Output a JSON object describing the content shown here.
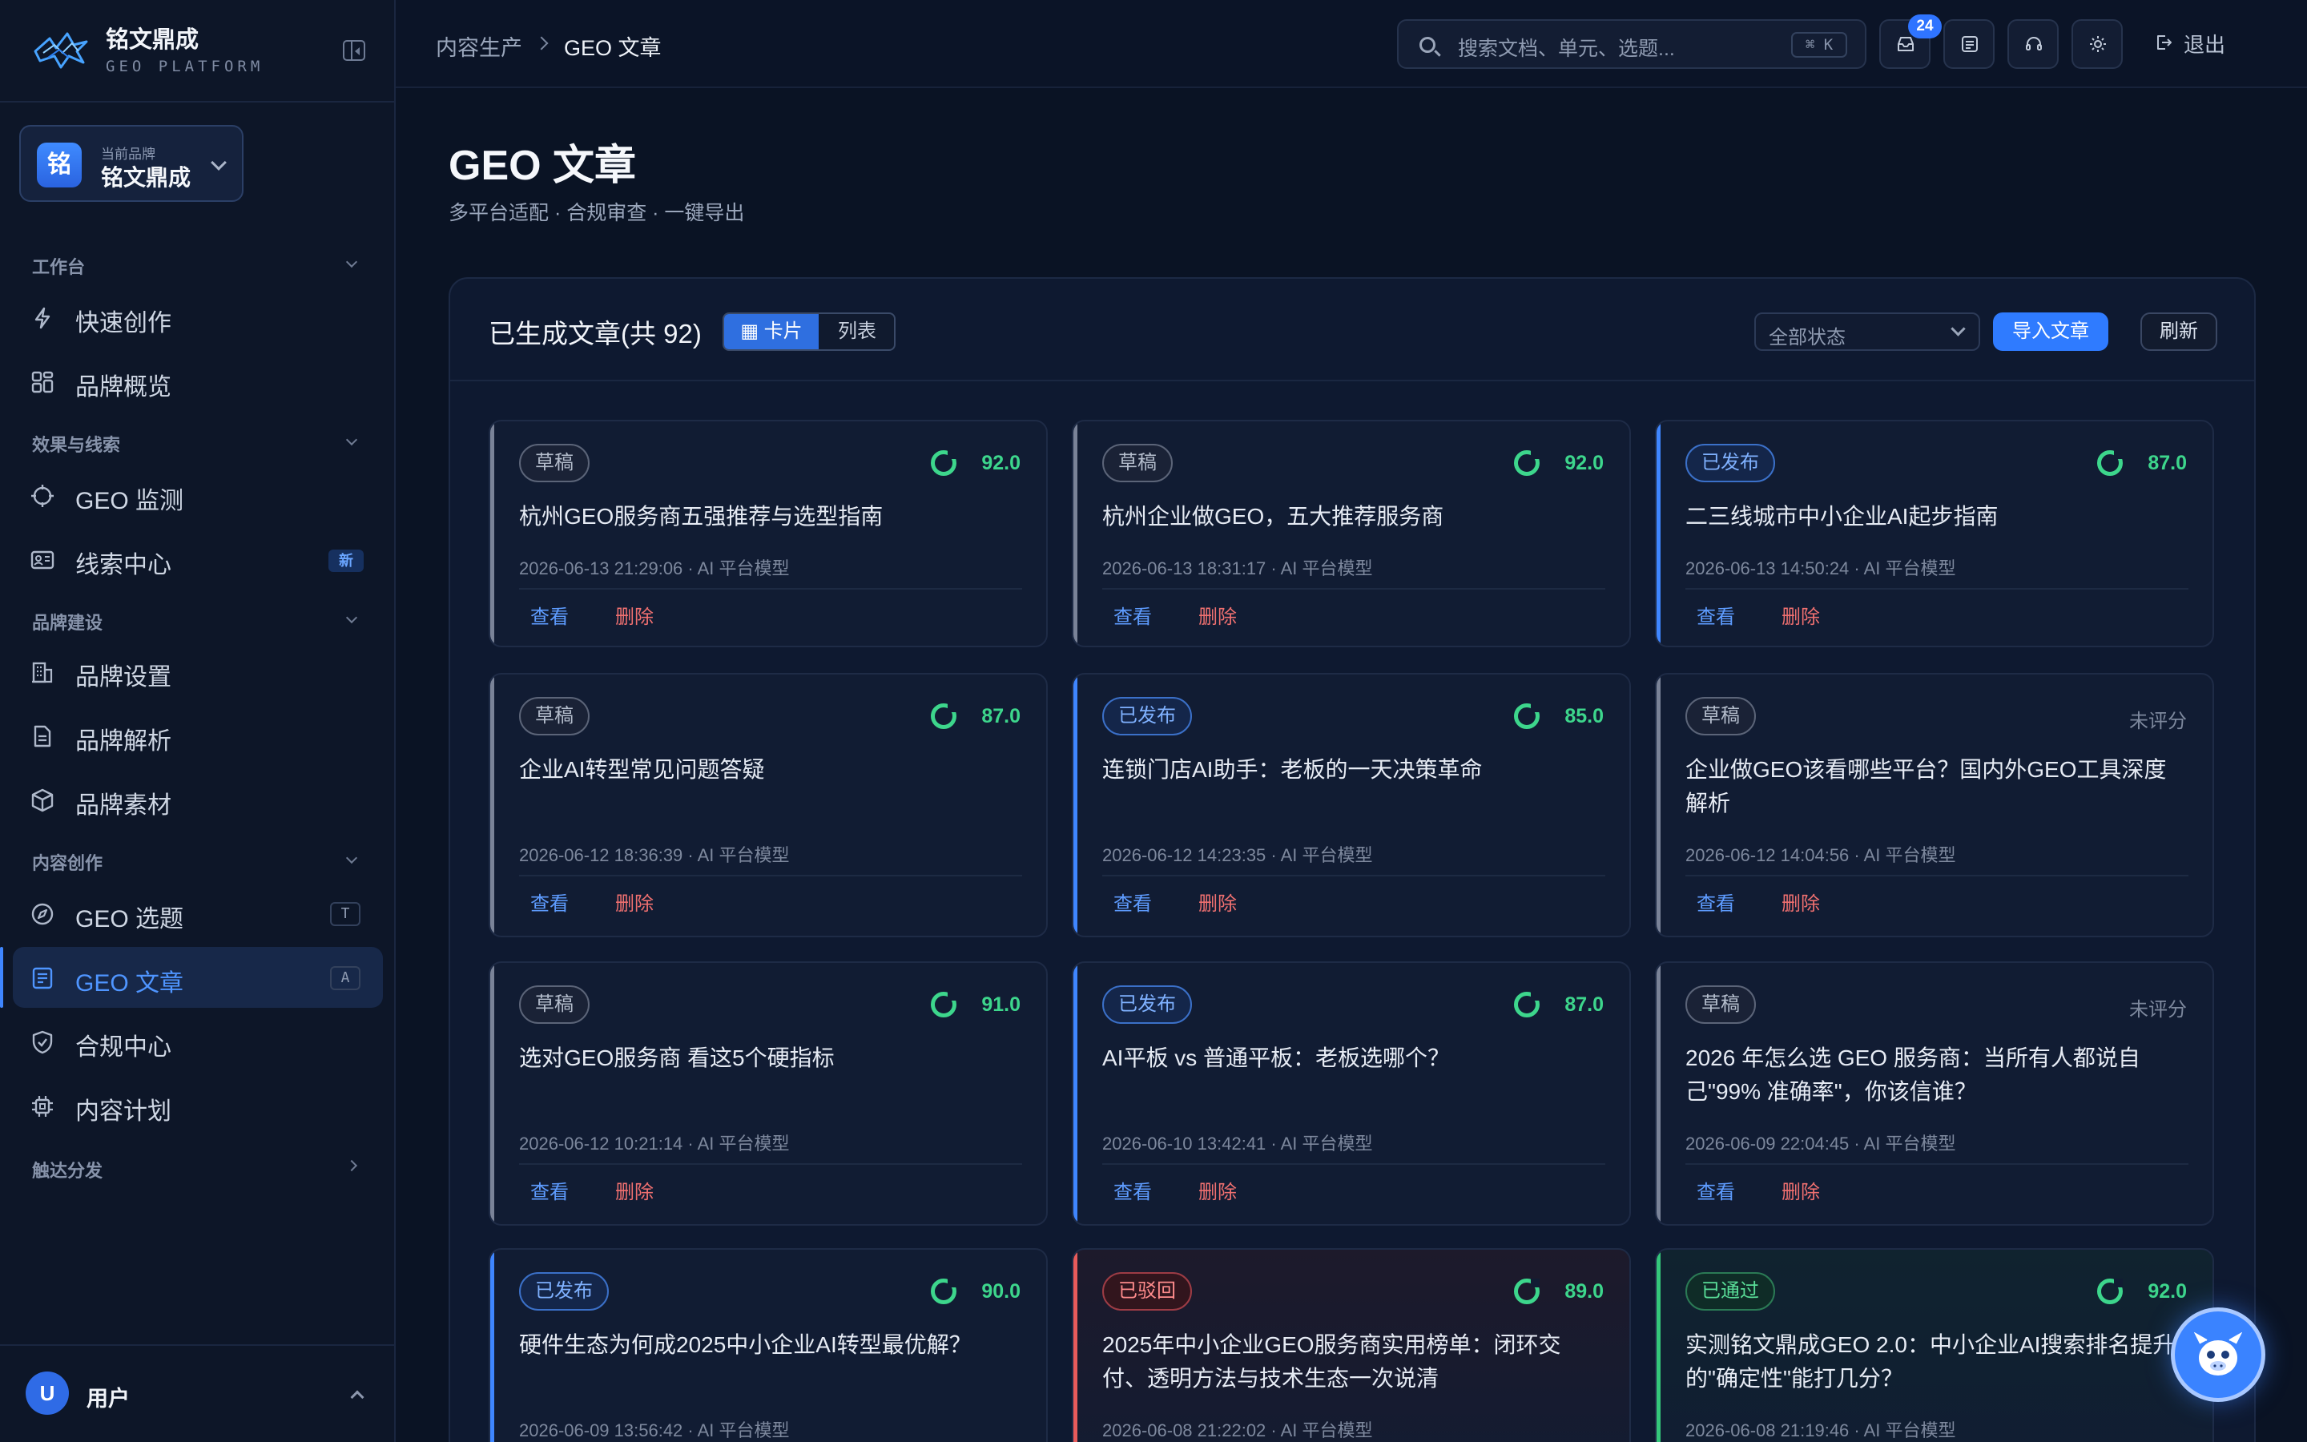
{
  "app": {
    "name": "铭文鼎成",
    "subtitle": "GEO PLATFORM"
  },
  "brand_switcher": {
    "caption": "当前品牌",
    "name": "铭文鼎成",
    "avatar": "铭"
  },
  "sidebar": {
    "groups": [
      {
        "label": "工作台"
      },
      {
        "label": "效果与线索"
      },
      {
        "label": "品牌建设"
      },
      {
        "label": "内容创作"
      },
      {
        "label": "触达分发"
      }
    ],
    "items": [
      {
        "label": "快速创作",
        "icon": "bolt-icon"
      },
      {
        "label": "品牌概览",
        "icon": "grid-icon"
      },
      {
        "label": "GEO 监测",
        "icon": "crosshair-icon"
      },
      {
        "label": "线索中心",
        "icon": "id-card-icon",
        "badge": "新"
      },
      {
        "label": "品牌设置",
        "icon": "building-icon"
      },
      {
        "label": "品牌解析",
        "icon": "document-icon"
      },
      {
        "label": "品牌素材",
        "icon": "cube-icon"
      },
      {
        "label": "GEO 选题",
        "icon": "compass-icon",
        "shortcut": "T"
      },
      {
        "label": "GEO 文章",
        "icon": "article-icon",
        "shortcut": "A",
        "active": true
      },
      {
        "label": "合规中心",
        "icon": "shield-check-icon"
      },
      {
        "label": "内容计划",
        "icon": "chip-icon"
      }
    ],
    "user": {
      "avatar": "U",
      "name": "用户"
    }
  },
  "topbar": {
    "breadcrumb": [
      "内容生产",
      "GEO 文章"
    ],
    "search_placeholder": "搜索文档、单元、选题...",
    "search_shortcut": "⌘ K",
    "inbox_badge": "24",
    "logout_label": "退出"
  },
  "page": {
    "title": "GEO 文章",
    "subtitle": "多平台适配 · 合规审查 · 一键导出"
  },
  "panel": {
    "title": "已生成文章(共 92)",
    "view_card": "▦ 卡片",
    "view_list": "列表",
    "status_filter": "全部状态",
    "import_label": "导入文章",
    "refresh_label": "刷新",
    "view_label": "查看",
    "delete_label": "删除"
  },
  "articles": [
    {
      "status": "草稿",
      "kind": "draft",
      "score": "92.0",
      "title": "杭州GEO服务商五强推荐与选型指南",
      "meta": "2026-06-13 21:29:06 · AI 平台模型"
    },
    {
      "status": "草稿",
      "kind": "draft",
      "score": "92.0",
      "title": "杭州企业做GEO，五大推荐服务商",
      "meta": "2026-06-13 18:31:17 · AI 平台模型"
    },
    {
      "status": "已发布",
      "kind": "published",
      "score": "87.0",
      "title": "二三线城市中小企业AI起步指南",
      "meta": "2026-06-13 14:50:24 · AI 平台模型"
    },
    {
      "status": "草稿",
      "kind": "draft",
      "score": "87.0",
      "title": "企业AI转型常见问题答疑",
      "meta": "2026-06-12 18:36:39 · AI 平台模型"
    },
    {
      "status": "已发布",
      "kind": "published",
      "score": "85.0",
      "title": "连锁门店AI助手：老板的一天决策革命",
      "meta": "2026-06-12 14:23:35 · AI 平台模型"
    },
    {
      "status": "草稿",
      "kind": "draft",
      "score": "未评分",
      "title": "企业做GEO该看哪些平台？国内外GEO工具深度解析",
      "meta": "2026-06-12 14:04:56 · AI 平台模型"
    },
    {
      "status": "草稿",
      "kind": "draft",
      "score": "91.0",
      "title": "选对GEO服务商 看这5个硬指标",
      "meta": "2026-06-12 10:21:14 · AI 平台模型"
    },
    {
      "status": "已发布",
      "kind": "published",
      "score": "87.0",
      "title": "AI平板 vs 普通平板：老板选哪个？",
      "meta": "2026-06-10 13:42:41 · AI 平台模型"
    },
    {
      "status": "草稿",
      "kind": "draft",
      "score": "未评分",
      "title": "2026 年怎么选 GEO 服务商：当所有人都说自己\"99% 准确率\"，你该信谁？",
      "meta": "2026-06-09 22:04:45 · AI 平台模型"
    },
    {
      "status": "已发布",
      "kind": "published",
      "score": "90.0",
      "title": "硬件生态为何成2025中小企业AI转型最优解？",
      "meta": "2026-06-09 13:56:42 · AI 平台模型"
    },
    {
      "status": "已驳回",
      "kind": "rejected",
      "score": "89.0",
      "title": "2025年中小企业GEO服务商实用榜单：闭环交付、透明方法与技术生态一次说清",
      "meta": "2026-06-08 21:22:02 · AI 平台模型"
    },
    {
      "status": "已通过",
      "kind": "passed",
      "score": "92.0",
      "title": "实测铭文鼎成GEO 2.0：中小企业AI搜索排名提升的\"确定性\"能打几分？",
      "meta": "2026-06-08 21:19:46 · AI 平台模型"
    }
  ]
}
